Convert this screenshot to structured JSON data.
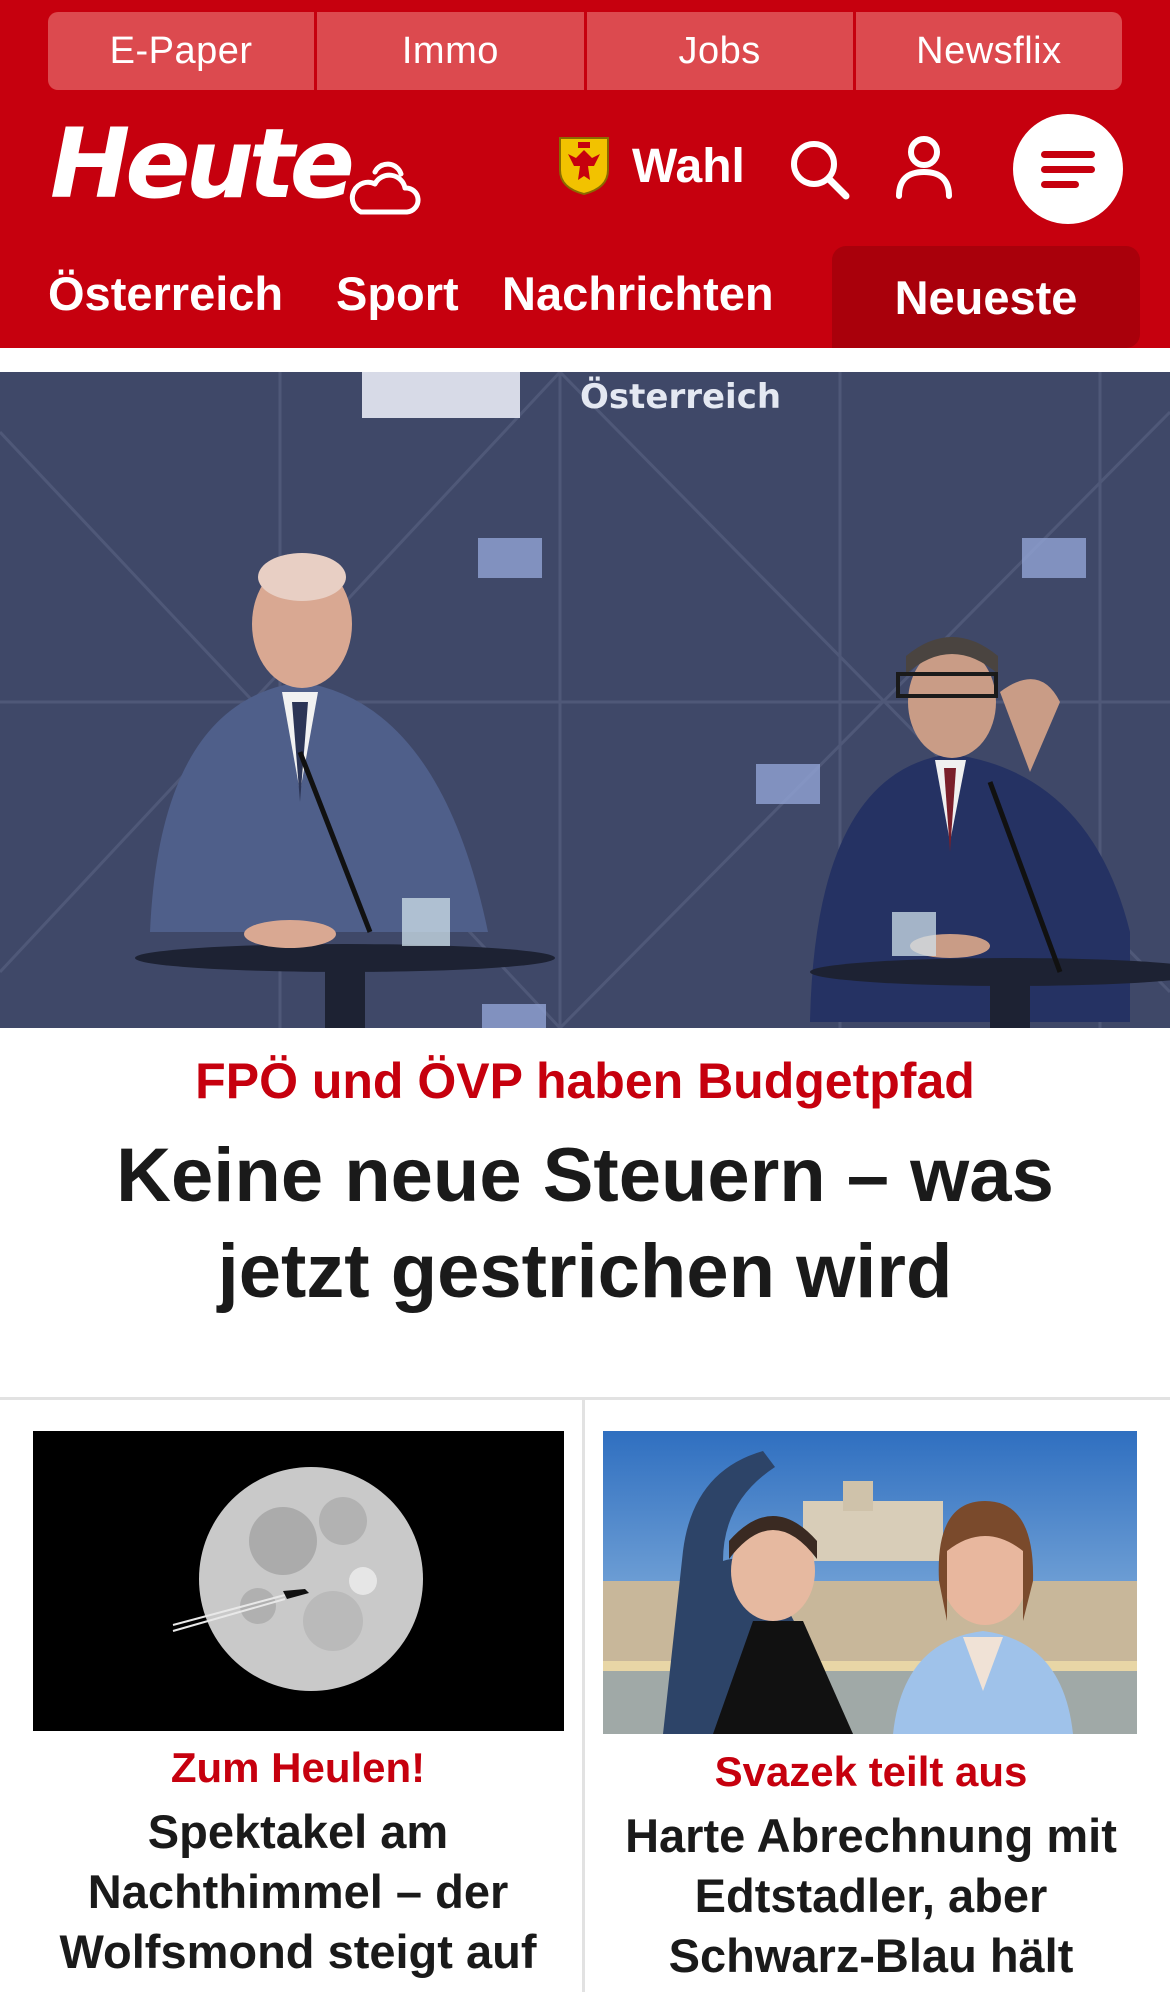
{
  "top_links": [
    "E-Paper",
    "Immo",
    "Jobs",
    "Newsflix"
  ],
  "brand": {
    "logo_text": "Heute",
    "weather_icon": "cloud-sun-icon",
    "wahl_label": "Wahl",
    "search_icon": "search-icon",
    "user_icon": "user-icon",
    "menu_icon": "hamburger-menu-icon"
  },
  "nav": {
    "items": [
      "Österreich",
      "Sport",
      "Nachrichten"
    ],
    "active": "Neueste"
  },
  "hero": {
    "backdrop_text": "Österreich",
    "kicker": "FPÖ und ÖVP haben Budgetpfad",
    "title": "Keine neue Steuern – was jetzt gestrichen wird"
  },
  "teasers": [
    {
      "kicker": "Zum Heulen!",
      "title": "Spektakel am Nachthimmel – der Wolfsmond steigt auf"
    },
    {
      "kicker": "Svazek teilt aus",
      "title": "Harte Abrechnung mit Edtstadler, aber Schwarz-Blau hält"
    }
  ],
  "colors": {
    "brand_red": "#c6000e",
    "top_link_bg": "#dc4a4f",
    "active_tab_bg": "#a9000b"
  }
}
